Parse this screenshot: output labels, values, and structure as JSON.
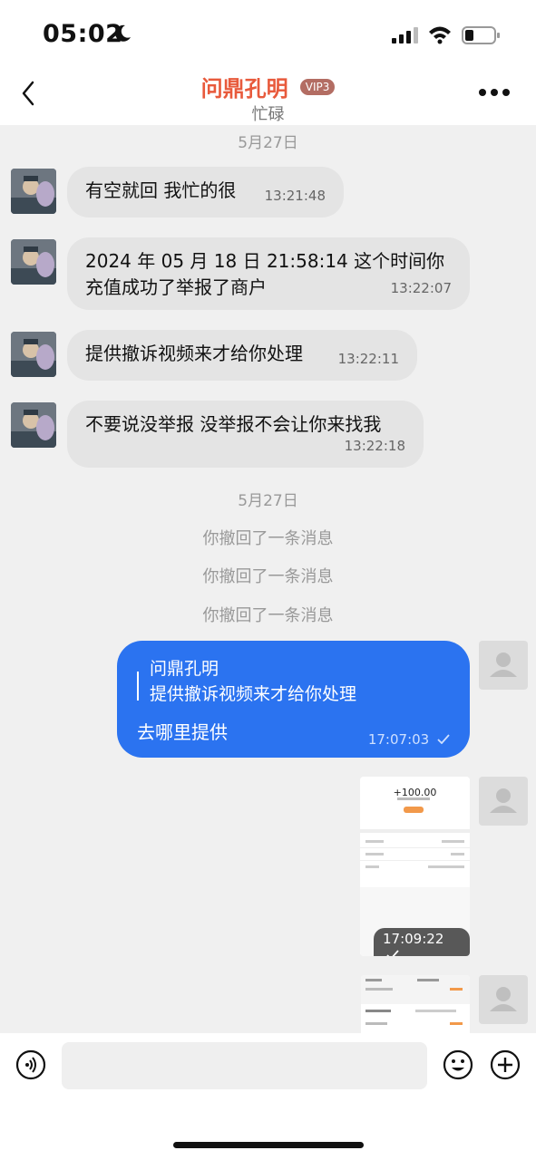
{
  "status_bar": {
    "time": "05:02"
  },
  "header": {
    "title": "问鼎孔明",
    "badge": "VIP3",
    "subtitle": "忙碌"
  },
  "messages": [
    {
      "date": "5月27日"
    },
    {
      "text": "有空就回 我忙的很",
      "time": "13:21:48"
    },
    {
      "text": "2024 年 05 月 18 日 21:58:14 这个时间你充值成功了举报了商户",
      "time": "13:22:07"
    },
    {
      "text": "提供撤诉视频来才给你处理",
      "time": "13:22:11"
    },
    {
      "text": "不要说没举报 没举报不会让你来找我",
      "time": "13:22:18"
    }
  ],
  "second_date": "5月27日",
  "recalls": [
    "你撤回了一条消息",
    "你撤回了一条消息",
    "你撤回了一条消息"
  ],
  "outgoing": {
    "quote_name": "问鼎孔明",
    "quote_text": "提供撤诉视频来才给你处理",
    "text": "去哪里提供",
    "time": "17:07:03"
  },
  "image_message": {
    "amount": "+100.00",
    "time": "17:09:22"
  },
  "colors": {
    "accent": "#2b73f0",
    "title": "#e85a3c"
  }
}
